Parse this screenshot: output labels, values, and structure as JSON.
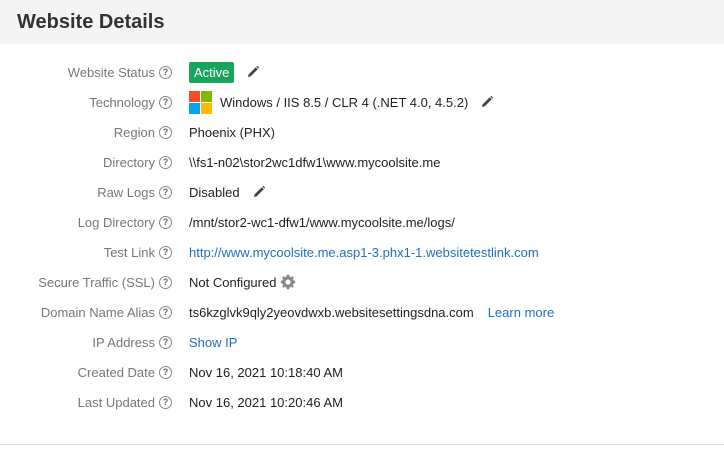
{
  "header": {
    "title": "Website Details"
  },
  "colors": {
    "active_badge": "#1aa35b",
    "link": "#1f6fbf",
    "label": "#777777"
  },
  "rows": [
    {
      "label": "Website Status",
      "value": "Active",
      "value_type": "badge",
      "action_icon": "pencil-icon"
    },
    {
      "label": "Technology",
      "value": "Windows / IIS 8.5 / CLR 4 (.NET 4.0, 4.5.2)",
      "icon": "windows-logo-icon",
      "action_icon": "pencil-icon"
    },
    {
      "label": "Region",
      "value": "Phoenix (PHX)"
    },
    {
      "label": "Directory",
      "value": "\\\\fs1-n02\\stor2wc1dfw1\\www.mycoolsite.me"
    },
    {
      "label": "Raw Logs",
      "value": "Disabled",
      "action_icon": "pencil-icon"
    },
    {
      "label": "Log Directory",
      "value": "/mnt/stor2-wc1-dfw1/www.mycoolsite.me/logs/"
    },
    {
      "label": "Test Link",
      "value": "http://www.mycoolsite.me.asp1-3.phx1-1.websitetestlink.com",
      "value_type": "link"
    },
    {
      "label": "Secure Traffic (SSL)",
      "value": "Not Configured",
      "action_icon": "gear-icon"
    },
    {
      "label": "Domain Name Alias",
      "value": "ts6kzglvk9qly2yeovdwxb.websitesettingsdna.com",
      "extra_link": "Learn more"
    },
    {
      "label": "IP Address",
      "value": "Show IP",
      "value_type": "link"
    },
    {
      "label": "Created Date",
      "value": "Nov 16, 2021 10:18:40 AM"
    },
    {
      "label": "Last Updated",
      "value": "Nov 16, 2021 10:20:46 AM"
    }
  ]
}
